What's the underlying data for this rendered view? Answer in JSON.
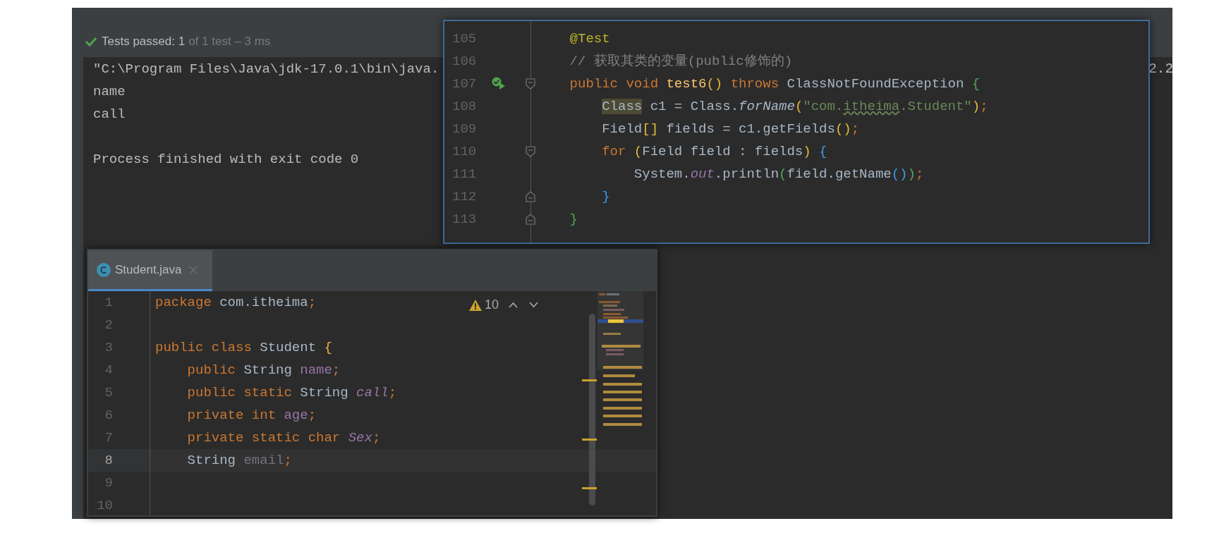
{
  "run_panel": {
    "status_label": "Tests passed: 1",
    "status_detail": "of 1 test – 3 ms",
    "console_lines": [
      {
        "text": "\"C:\\Program Files\\Java\\jdk-17.0.1\\bin\\java.",
        "blank_line_before": false
      },
      {
        "text": "name",
        "blank_line_before": false
      },
      {
        "text": "call",
        "blank_line_before": false
      },
      {
        "text": "Process finished with exit code 0",
        "blank_line_before": true
      }
    ],
    "console_tail": "2.2"
  },
  "popup_editor": {
    "lines": [
      {
        "number": "105",
        "run": false,
        "fold_start": false,
        "fold_end": false,
        "tokens": [
          {
            "text": "    @Test",
            "kind": "annotation"
          }
        ]
      },
      {
        "number": "106",
        "run": false,
        "fold_start": false,
        "fold_end": false,
        "tokens": [
          {
            "text": "    // 获取其类的变量(public修饰的)",
            "kind": "comment"
          }
        ]
      },
      {
        "number": "107",
        "run": true,
        "fold_start": true,
        "fold_end": false,
        "tokens": [
          {
            "text": "    public void ",
            "kind": "keyword"
          },
          {
            "text": "test6",
            "kind": "decl"
          },
          {
            "text": "()",
            "kind": "paren1"
          },
          {
            "text": " throws ",
            "kind": "keyword"
          },
          {
            "text": "ClassNotFoundException ",
            "kind": "plain"
          },
          {
            "text": "{",
            "kind": "paren2"
          }
        ]
      },
      {
        "number": "108",
        "run": false,
        "fold_start": false,
        "fold_end": false,
        "tokens": [
          {
            "text": "        Class",
            "kind": "highlight"
          },
          {
            "text": " c1 = Class.",
            "kind": "plain"
          },
          {
            "text": "forName",
            "kind": "italic"
          },
          {
            "text": "(",
            "kind": "paren1"
          },
          {
            "text": "\"com.",
            "kind": "string"
          },
          {
            "text": "itheima",
            "kind": "typo"
          },
          {
            "text": ".Student\"",
            "kind": "string"
          },
          {
            "text": ")",
            "kind": "paren1"
          },
          {
            "text": ";",
            "kind": "keyword"
          }
        ]
      },
      {
        "number": "109",
        "run": false,
        "fold_start": false,
        "fold_end": false,
        "tokens": [
          {
            "text": "        Field",
            "kind": "plain"
          },
          {
            "text": "[]",
            "kind": "paren1"
          },
          {
            "text": " fields = c1.getFields",
            "kind": "plain"
          },
          {
            "text": "()",
            "kind": "paren1"
          },
          {
            "text": ";",
            "kind": "keyword"
          }
        ]
      },
      {
        "number": "110",
        "run": false,
        "fold_start": true,
        "fold_end": false,
        "tokens": [
          {
            "text": "        for ",
            "kind": "keyword"
          },
          {
            "text": "(",
            "kind": "paren1"
          },
          {
            "text": "Field field : fields",
            "kind": "plain"
          },
          {
            "text": ") ",
            "kind": "paren1"
          },
          {
            "text": "{",
            "kind": "paren3"
          }
        ]
      },
      {
        "number": "111",
        "run": false,
        "fold_start": false,
        "fold_end": false,
        "tokens": [
          {
            "text": "            System.",
            "kind": "plain"
          },
          {
            "text": "out",
            "kind": "static"
          },
          {
            "text": ".println",
            "kind": "plain"
          },
          {
            "text": "(",
            "kind": "paren2"
          },
          {
            "text": "field.getName",
            "kind": "plain"
          },
          {
            "text": "()",
            "kind": "paren3"
          },
          {
            "text": ")",
            "kind": "paren2"
          },
          {
            "text": ";",
            "kind": "keyword"
          }
        ]
      },
      {
        "number": "112",
        "run": false,
        "fold_start": false,
        "fold_end": true,
        "tokens": [
          {
            "text": "        }",
            "kind": "paren3"
          }
        ]
      },
      {
        "number": "113",
        "run": false,
        "fold_start": false,
        "fold_end": true,
        "tokens": [
          {
            "text": "    }",
            "kind": "paren2"
          }
        ]
      }
    ]
  },
  "editor": {
    "tab": {
      "label": "Student.java",
      "selected": true
    },
    "warning_count": "10",
    "lines": [
      {
        "number": "1",
        "current": false,
        "tokens": [
          {
            "text": "package ",
            "kind": "keyword"
          },
          {
            "text": "com.itheima",
            "kind": "plain"
          },
          {
            "text": ";",
            "kind": "keyword"
          }
        ]
      },
      {
        "number": "2",
        "current": false
      },
      {
        "number": "3",
        "current": false,
        "tokens": [
          {
            "text": "public class ",
            "kind": "keyword"
          },
          {
            "text": "Student ",
            "kind": "plain"
          },
          {
            "text": "{",
            "kind": "paren1"
          }
        ]
      },
      {
        "number": "4",
        "current": false,
        "tokens": [
          {
            "text": "    public ",
            "kind": "keyword"
          },
          {
            "text": "String ",
            "kind": "plain"
          },
          {
            "text": "name",
            "kind": "field"
          },
          {
            "text": ";",
            "kind": "keyword"
          }
        ]
      },
      {
        "number": "5",
        "current": false,
        "tokens": [
          {
            "text": "    public static ",
            "kind": "keyword"
          },
          {
            "text": "String ",
            "kind": "plain"
          },
          {
            "text": "call",
            "kind": "static"
          },
          {
            "text": ";",
            "kind": "keyword"
          }
        ]
      },
      {
        "number": "6",
        "current": false,
        "tokens": [
          {
            "text": "    private int ",
            "kind": "keyword"
          },
          {
            "text": "age",
            "kind": "field"
          },
          {
            "text": ";",
            "kind": "keyword"
          }
        ]
      },
      {
        "number": "7",
        "current": false,
        "tokens": [
          {
            "text": "    private static char ",
            "kind": "keyword"
          },
          {
            "text": "Sex",
            "kind": "static"
          },
          {
            "text": ";",
            "kind": "keyword"
          }
        ]
      },
      {
        "number": "8",
        "current": true,
        "tokens": [
          {
            "text": "    String ",
            "kind": "plain"
          },
          {
            "text": "email",
            "kind": "unused"
          },
          {
            "text": ";",
            "kind": "keyword"
          }
        ]
      },
      {
        "number": "9",
        "current": false
      },
      {
        "number": "10",
        "current": false
      }
    ]
  }
}
